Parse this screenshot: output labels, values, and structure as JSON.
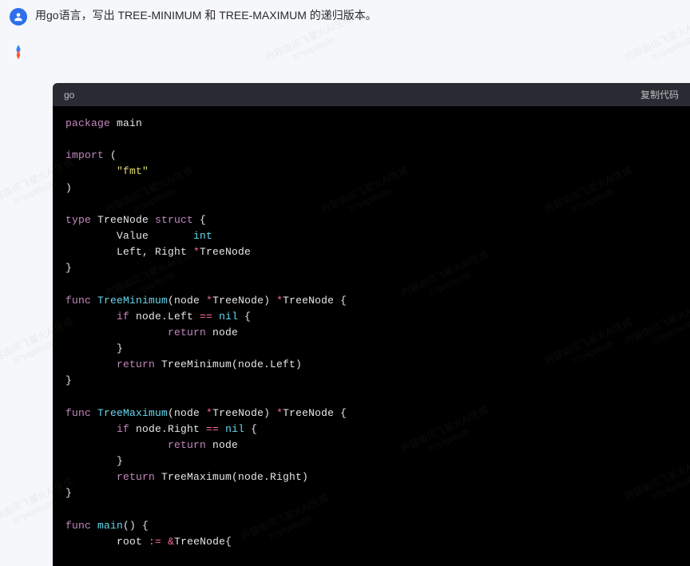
{
  "user": {
    "prompt": "用go语言，写出 TREE-MINIMUM 和 TREE-MAXIMUM 的递归版本。"
  },
  "codeblock": {
    "language": "go",
    "copy_label": "复制代码"
  },
  "code": {
    "l1_kw": "package",
    "l1_rest": " main",
    "l3_kw": "import",
    "l3_rest": " (",
    "l4_indent": "        ",
    "l4_str": "\"fmt\"",
    "l5": ")",
    "l7_kw": "type",
    "l7_name": " TreeNode ",
    "l7_kw2": "struct",
    "l7_rest": " {",
    "l8_indent": "        ",
    "l8_field": "Value       ",
    "l8_type": "int",
    "l9_indent": "        ",
    "l9_field": "Left, Right ",
    "l9_op": "*",
    "l9_type": "TreeNode",
    "l10": "}",
    "l12_kw": "func",
    "l12_name": " TreeMinimum",
    "l12_sig": "(node ",
    "l12_op": "*",
    "l12_t1": "TreeNode) ",
    "l12_op2": "*",
    "l12_t2": "TreeNode {",
    "l13_indent": "        ",
    "l13_kw": "if",
    "l13_rest": " node.Left ",
    "l13_op": "==",
    "l13_sp": " ",
    "l13_nil": "nil",
    "l13_end": " {",
    "l14_indent": "                ",
    "l14_kw": "return",
    "l14_rest": " node",
    "l15_indent": "        ",
    "l15": "}",
    "l16_indent": "        ",
    "l16_kw": "return",
    "l16_rest": " TreeMinimum(node.Left)",
    "l17": "}",
    "l19_kw": "func",
    "l19_name": " TreeMaximum",
    "l19_sig": "(node ",
    "l19_op": "*",
    "l19_t1": "TreeNode) ",
    "l19_op2": "*",
    "l19_t2": "TreeNode {",
    "l20_indent": "        ",
    "l20_kw": "if",
    "l20_rest": " node.Right ",
    "l20_op": "==",
    "l20_sp": " ",
    "l20_nil": "nil",
    "l20_end": " {",
    "l21_indent": "                ",
    "l21_kw": "return",
    "l21_rest": " node",
    "l22_indent": "        ",
    "l22": "}",
    "l23_indent": "        ",
    "l23_kw": "return",
    "l23_rest": " TreeMaximum(node.Right)",
    "l24": "}",
    "l26_kw": "func",
    "l26_name": " main",
    "l26_rest": "() {",
    "l27_indent": "        ",
    "l27_a": "root ",
    "l27_op": ":=",
    "l27_b": " ",
    "l27_amp": "&",
    "l27_c": "TreeNode{"
  },
  "watermark": {
    "line1": "内容由讯飞星火AI生成",
    "line2": "2i7p4plf6u9b"
  }
}
